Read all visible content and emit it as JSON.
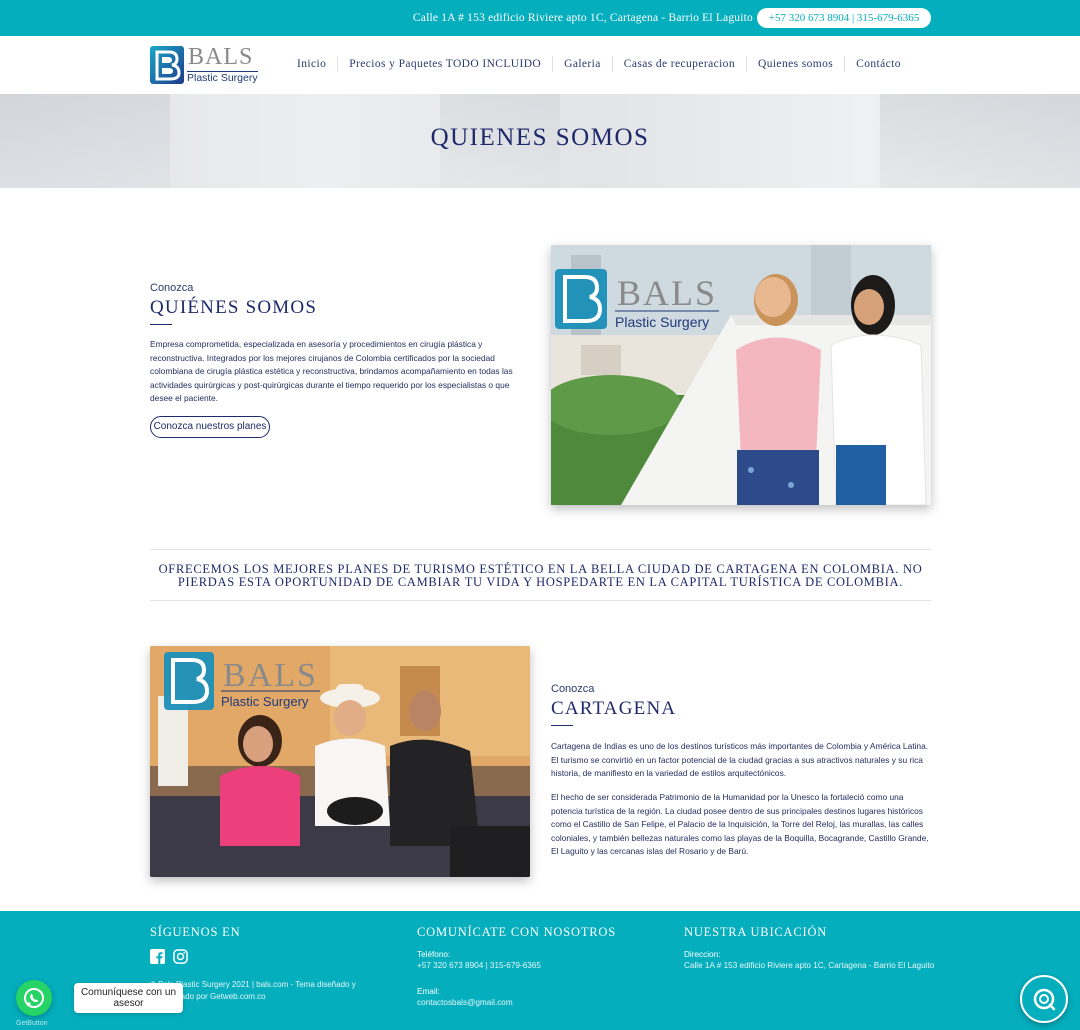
{
  "topbar": {
    "address": "Calle 1A # 153 edificio Riviere apto 1C, Cartagena - Barrio El Laguito",
    "phone": "+57 320 673 8904 | 315-679-6365"
  },
  "logo": {
    "name": "BALS",
    "tagline": "Plastic Surgery",
    "icon": "bals-b-logo-icon"
  },
  "nav": {
    "items": [
      {
        "label": "Inicio"
      },
      {
        "label": "Precios y Paquetes TODO INCLUIDO"
      },
      {
        "label": "Galeria"
      },
      {
        "label": "Casas de recuperacion"
      },
      {
        "label": "Quienes somos"
      },
      {
        "label": "Contácto"
      }
    ]
  },
  "hero": {
    "title": "QUIENES SOMOS"
  },
  "about": {
    "kicker": "Conozca",
    "title": "QUIÉNES SOMOS",
    "body": "Empresa comprometida, especializada en asesoría y procedimientos en cirugía plástica y reconstructiva. Integrados por los mejores cirujanos de Colombia certificados por  la sociedad colombiana de cirugía plástica estética y reconstructiva, brindamos acompañamiento en todas las actividades quirúrgicas y post-quirúrgicas durante el tiempo requerido por los especialistas o que desee el paciente.",
    "button": "Conozca nuestros planes",
    "image_logo": "BALS",
    "image_tagline": "Plastic Surgery"
  },
  "banner": {
    "text": "OFRECEMOS LOS MEJORES PLANES DE TURISMO ESTÉTICO EN LA BELLA CIUDAD DE CARTAGENA EN COLOMBIA. NO PIERDAS ESTA OPORTUNIDAD DE CAMBIAR TU VIDA Y HOSPEDARTE EN LA CAPITAL TURÍSTICA DE COLOMBIA."
  },
  "cartagena": {
    "kicker": "Conozca",
    "title": "CARTAGENA",
    "para1": "Cartagena de Indias es uno de los destinos turísticos más importantes de Colombia y América Latina. El turismo se convirtió en un factor potencial de la ciudad gracias a sus atractivos naturales y su rica historia, de manifiesto en la variedad de estilos arquitectónicos.",
    "para2": "El hecho de ser considerada Patrimonio de la Humanidad por la Unesco la fortaleció como una potencia turística de la región. La ciudad posee dentro de sus principales destinos lugares históricos como el Castillo de San Felipe, el Palacio de la Inquisición, la Torre del Reloj, las murallas, las calles coloniales, y también bellezas naturales como las playas de la Boquilla, Bocagrande, Castillo Grande, El Laguito y las cercanas islas del Rosario y de Barú.",
    "image_logo": "BALS",
    "image_tagline": "Plastic Surgery"
  },
  "footer": {
    "follow": {
      "title": "SÍGUENOS EN",
      "icons": [
        "facebook-icon",
        "instagram-icon"
      ]
    },
    "copyright": "© Bals Plastic Surgery 2021 | bals.com - Tema diseñado y desarrollado por Getweb.com.co",
    "contact": {
      "title": "COMUNÍCATE CON NOSOTROS",
      "phone_label": "Teléfono:",
      "phone": "+57 320 673 8904 | 315-679-6365",
      "email_label": "Email:",
      "email": "contactosbals@gmail.com"
    },
    "location": {
      "title": "NUESTRA UBICACIÓN",
      "address_label": "Direccion:",
      "address": "Calle 1A # 153 edificio Riviere apto 1C, Cartagena - Barrio El Laguito"
    }
  },
  "whatsapp": {
    "tooltip": "Comuníquese con un asesor",
    "brand": "GetButton"
  },
  "colors": {
    "teal": "#04aebd",
    "navy": "#1f2a6a",
    "whatsapp": "#25d366"
  }
}
